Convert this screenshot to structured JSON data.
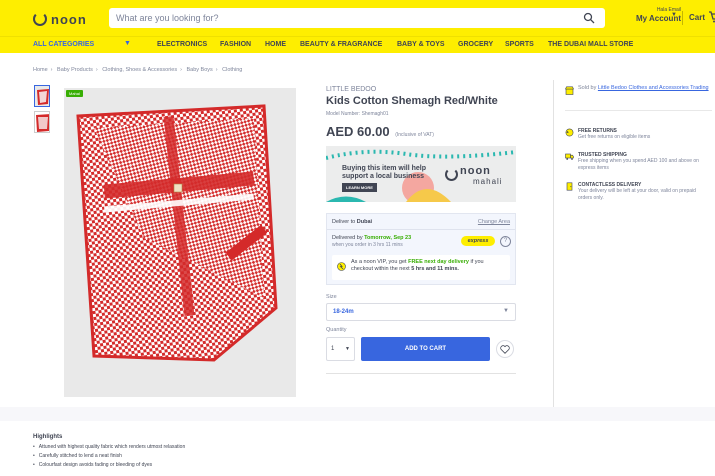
{
  "header": {
    "logo_text": "noon",
    "search_placeholder": "What are you looking for?",
    "account_greeting": "Hala Email",
    "account_label": "My Account",
    "cart_label": "Cart"
  },
  "nav": {
    "items": [
      "ALL CATEGORIES",
      "ELECTRONICS",
      "FASHION",
      "HOME",
      "BEAUTY & FRAGRANCE",
      "BABY & TOYS",
      "GROCERY",
      "SPORTS",
      "THE DUBAI MALL STORE"
    ]
  },
  "breadcrumb": [
    "Home",
    "Baby Products",
    "Clothing, Shoes & Accessories",
    "Baby Boys",
    "Clothing"
  ],
  "product": {
    "badge": "Mahal",
    "brand": "LITTLE BEDOO",
    "title": "Kids Cotton Shemagh Red/White",
    "model": "Model Number: Shemagh01",
    "price": "AED 60.00",
    "price_note": "(Inclusive of VAT)"
  },
  "banner": {
    "text": "Buying this item will help support a local business",
    "button": "LEARN MORE",
    "logo_top": "noon",
    "logo_bottom": "mahali"
  },
  "delivery": {
    "deliver_to_prefix": "Deliver to",
    "deliver_to_city": "Dubai",
    "change_area": "Change Area",
    "delivered_by_prefix": "Delivered by",
    "delivered_date": "Tomorrow, Sep 23",
    "order_within": "when you order in 3 hrs 11 mins",
    "express_label": "express",
    "vip_prefix": "As a noon VIP, you get",
    "vip_highlight": "FREE next day delivery",
    "vip_mid": "if you checkout within the next",
    "vip_time": "5 hrs and 11 mins."
  },
  "options": {
    "size_label": "Size",
    "size_value": "18-24m",
    "qty_label": "Quantity",
    "qty_value": "1",
    "add_to_cart": "ADD TO CART"
  },
  "seller": {
    "sold_by_prefix": "Sold by",
    "seller_name": "Little Bedoo Clothes and Accessories Trading"
  },
  "features": [
    {
      "title": "FREE RETURNS",
      "desc": "Get free returns on eligible items"
    },
    {
      "title": "TRUSTED SHIPPING",
      "desc": "Free shipping when you spend AED 100 and above on express items"
    },
    {
      "title": "CONTACTLESS DELIVERY",
      "desc": "Your delivery will be left at your door, valid on prepaid orders only."
    }
  ],
  "highlights": {
    "title": "Highlights",
    "items": [
      "Attuned with highest quality fabric which renders utmost relaxation",
      "Carefully stitched to lend a neat finish",
      "Colourfast design avoids fading or bleeding of dyes"
    ]
  },
  "colors": {
    "brand_yellow": "#feee00",
    "accent_blue": "#3866df",
    "success_green": "#38ae04",
    "text_dark": "#404553"
  }
}
